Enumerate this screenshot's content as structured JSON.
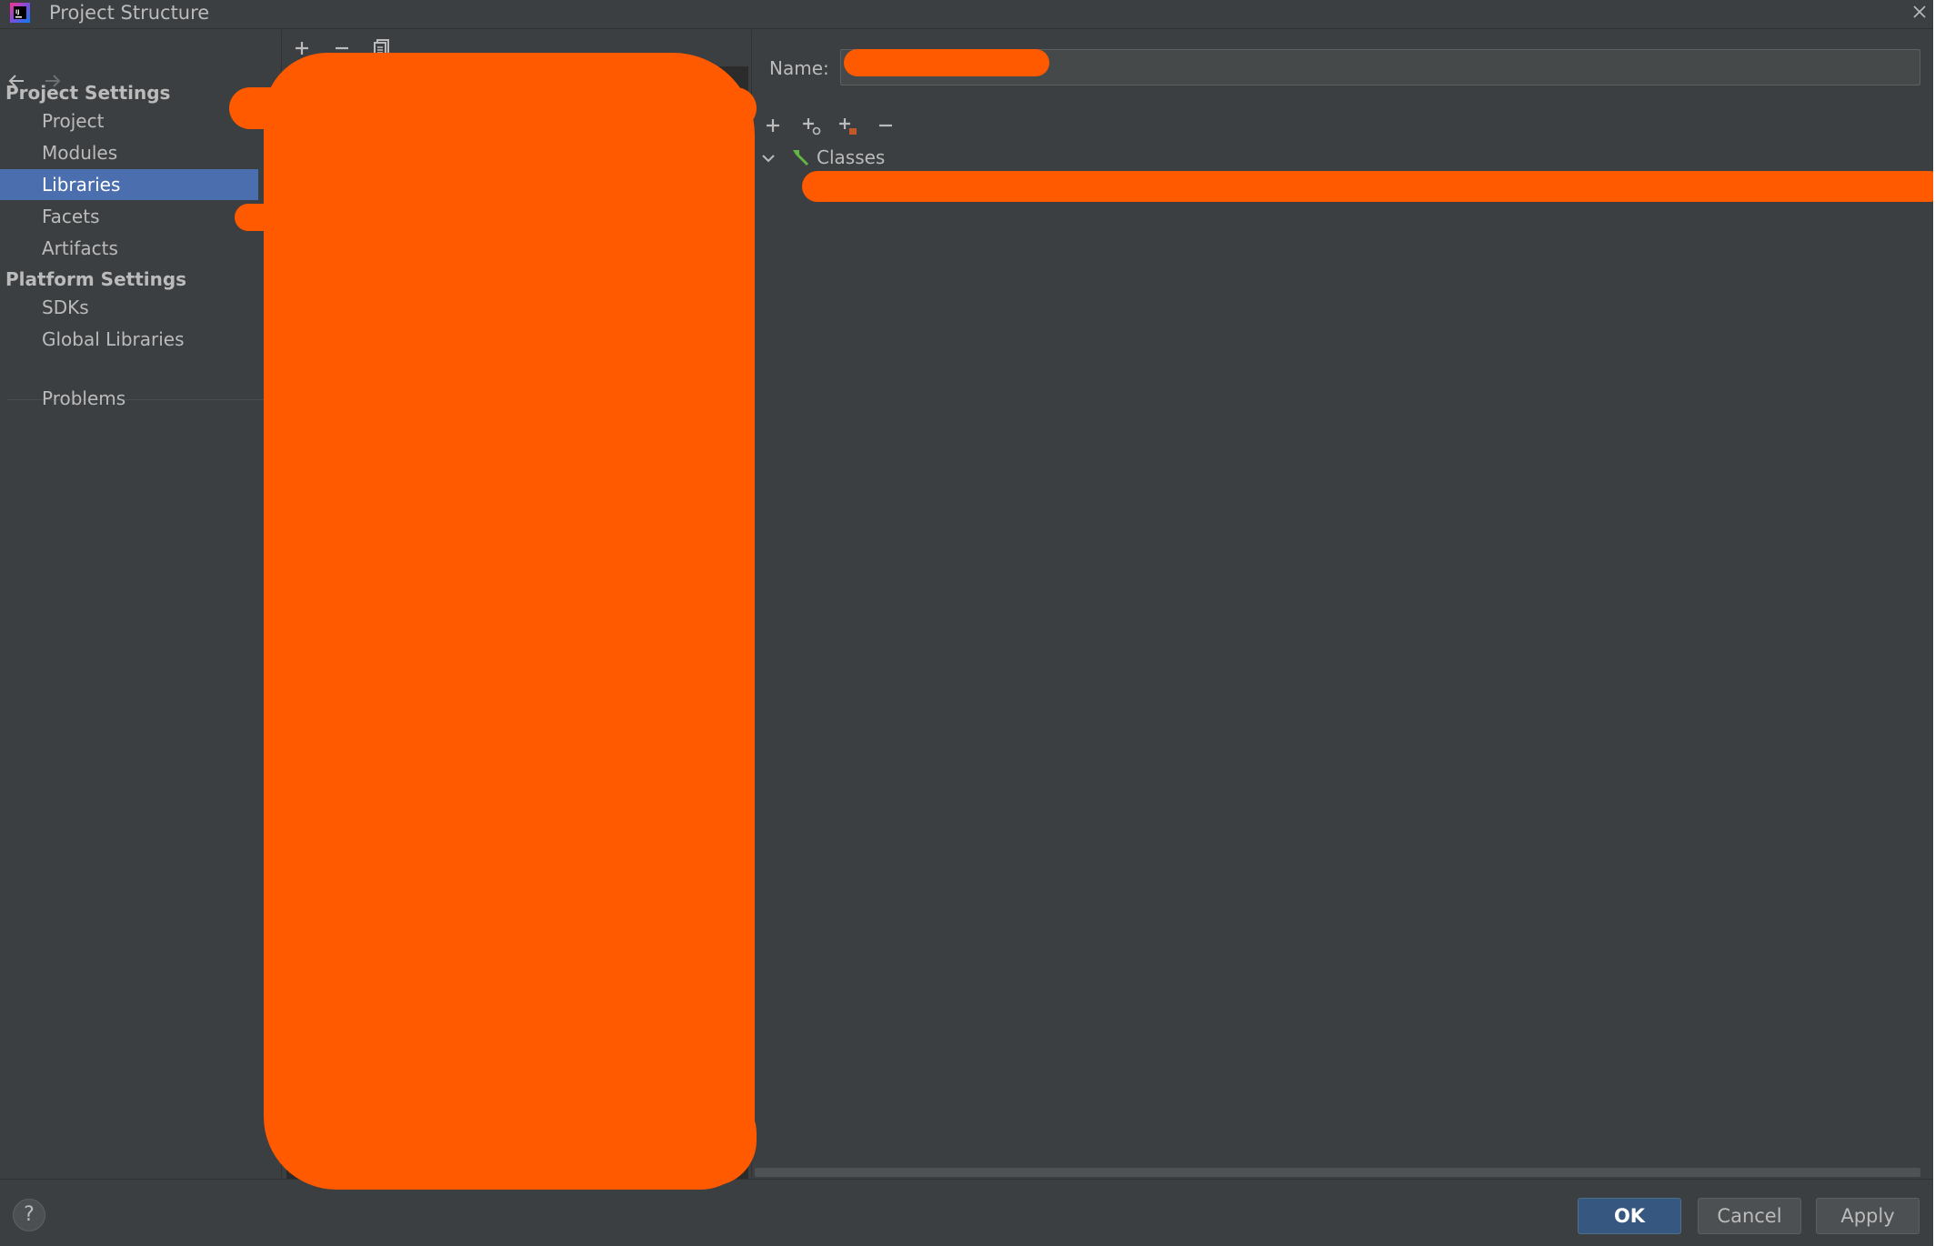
{
  "window": {
    "title": "Project Structure"
  },
  "nav": {
    "sections": [
      {
        "label": "Project Settings",
        "items": [
          {
            "label": "Project",
            "selected": false
          },
          {
            "label": "Modules",
            "selected": false
          },
          {
            "label": "Libraries",
            "selected": true
          },
          {
            "label": "Facets",
            "selected": false
          },
          {
            "label": "Artifacts",
            "selected": false
          }
        ]
      },
      {
        "label": "Platform Settings",
        "items": [
          {
            "label": "SDKs",
            "selected": false
          },
          {
            "label": "Global Libraries",
            "selected": false
          }
        ]
      }
    ],
    "problems_label": "Problems"
  },
  "detail": {
    "name_label": "Name:",
    "name_value": "",
    "tree": {
      "root_label": "Classes",
      "expanded": true
    }
  },
  "buttons": {
    "help": "?",
    "ok": "OK",
    "cancel": "Cancel",
    "apply": "Apply"
  },
  "colors": {
    "background": "#3c3f41",
    "selection": "#4b6eaf",
    "ok_button": "#365880",
    "redaction": "#ff5a00"
  },
  "icons": {
    "app": "intellij-idea-icon",
    "back": "arrow-left-icon",
    "forward": "arrow-right-icon",
    "close": "close-icon",
    "add": "plus-icon",
    "remove": "minus-icon",
    "copy": "copy-icon",
    "library_node": "hammer-icon"
  }
}
